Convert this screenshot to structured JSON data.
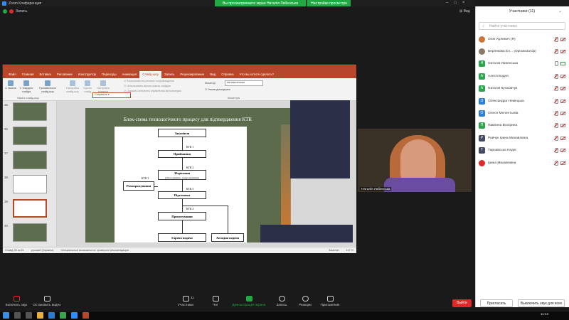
{
  "window": {
    "title": "Zoom Конференция",
    "view_button": "Вид"
  },
  "banner": {
    "text": "Вы просматриваете экран Наталія Лабенська",
    "options": "Настройки просмотра"
  },
  "status": {
    "recording": "Запись"
  },
  "powerpoint": {
    "tabs": [
      "Файл",
      "Главная",
      "Вставка",
      "Рисование",
      "Конструктор",
      "Переходы",
      "Анимация",
      "Слайд-шоу",
      "Запись",
      "Рецензирование",
      "Вид",
      "Справка",
      "Что вы хотите сделать?"
    ],
    "active_tab": "Слайд-шоу",
    "ribbon": {
      "btn_start": "С начала",
      "btn_current": "С текущего слайда",
      "btn_custom": "Произвольное слайд-шоу",
      "group_start": "Начать слайд-шоу",
      "btn_setup": "Настройка слайд-шоу",
      "btn_hide": "Скрыть слайд",
      "btn_rehearse": "Настройка времени",
      "opt1": "Воспроизвести речевое сопровождение",
      "opt2": "Использовать время показа слайдов",
      "opt3": "Показать элементы управления мультимедиа",
      "dropdown": "Сохранить",
      "monitor_label": "Монитор:",
      "monitor_value": "Автоматически",
      "presenter": "Режим докладчика",
      "group_monitors": "Мониторы"
    },
    "slide_numbers": [
      "35",
      "36",
      "37",
      "38",
      "39",
      "40"
    ],
    "slide": {
      "title": "Блок-схема технологічного процесу для підтвердження КТК",
      "boxes": [
        "Закупівля",
        "Приймання",
        "Зберігання",
        "Розморожування",
        "Підготовка",
        "Приготування",
        "Гаряча подача",
        "Холодна подача"
      ],
      "sub_storage": "(Охолодження, заморожування)",
      "ktk": [
        "КТК 1",
        "КТК 2",
        "КТК 3",
        "КТК 3",
        "КТК 4"
      ]
    },
    "statusbar": {
      "slide": "Слайд 39 из 51",
      "lang": "русский (Украина)",
      "accessibility": "Специальные возможности: проверьте рекомендации",
      "notes": "Заметки",
      "zoom": "117 %"
    }
  },
  "video": {
    "name": "Наталія Лабенська"
  },
  "participants": {
    "title": "Участники (11)",
    "search_placeholder": "Найти участника",
    "list": [
      {
        "initial": "",
        "name": "Олег Кулинич (Я)",
        "color": "#c9753b",
        "avatar": true
      },
      {
        "initial": "",
        "name": "Берлякова Ел... (Организатор)",
        "color": "#8a7a66",
        "avatar": true
      },
      {
        "initial": "Н",
        "name": "Наталія Лабенська",
        "color": "#2da44e"
      },
      {
        "initial": "А",
        "name": "Алеся Бодня",
        "color": "#2da44e"
      },
      {
        "initial": "А",
        "name": "Наталія Кульбачук",
        "color": "#2da44e"
      },
      {
        "initial": "О",
        "name": "Олександра Немецька",
        "color": "#2d7fd0"
      },
      {
        "initial": "О",
        "name": "Олеся Мелентьєва",
        "color": "#2d7fd0"
      },
      {
        "initial": "П",
        "name": "Павлина Возгрина",
        "color": "#2da44e"
      },
      {
        "initial": "Р",
        "name": "Райчук Ірина Михайлівна",
        "color": "#444a63"
      },
      {
        "initial": "Т",
        "name": "Тарнавська Надія",
        "color": "#444a63"
      },
      {
        "initial": "",
        "name": "Ірина Михайлівна",
        "color": "#e02828",
        "avatar": true
      }
    ],
    "invite": "Пригласить",
    "mute_all": "Выключить звук для всех"
  },
  "toolbar": {
    "mute": "Включить звук",
    "video": "Остановить видео",
    "participants": "Участники",
    "participants_count": "11",
    "chat": "Чат",
    "share": "Демонстрация экрана",
    "record": "Запись",
    "reactions": "Реакции",
    "apps": "Приложения",
    "end": "Выйти"
  },
  "taskbar": {
    "time": "11:42"
  }
}
